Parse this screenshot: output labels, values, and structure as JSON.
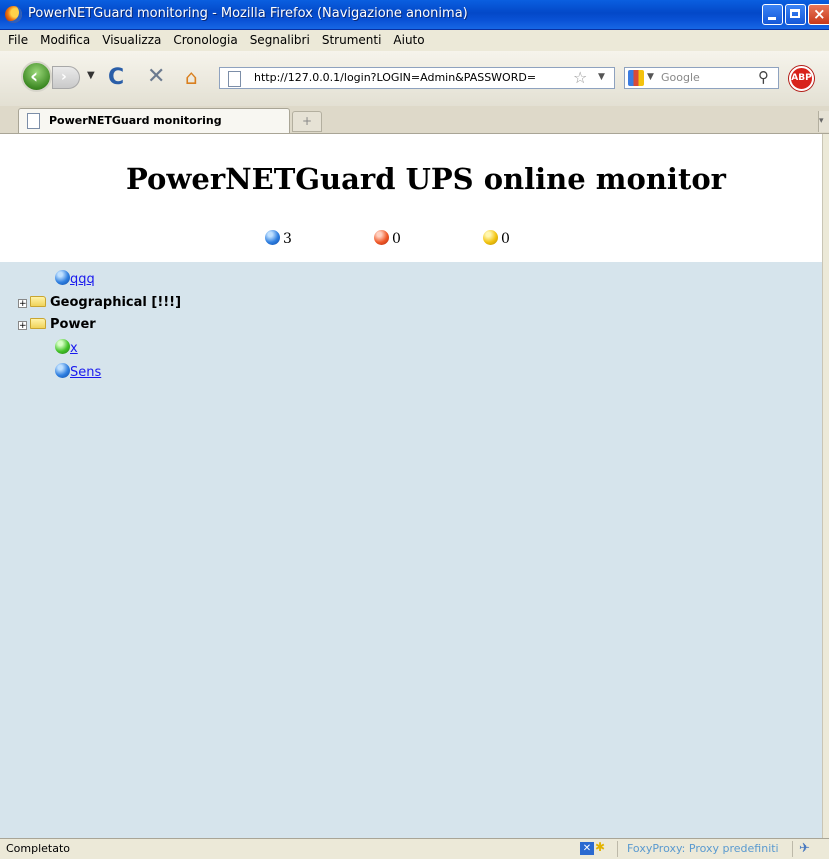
{
  "window": {
    "title": "PowerNETGuard monitoring - Mozilla Firefox (Navigazione anonima)"
  },
  "menu": [
    "File",
    "Modifica",
    "Visualizza",
    "Cronologia",
    "Segnalibri",
    "Strumenti",
    "Aiuto"
  ],
  "navbar": {
    "url": "http://127.0.0.1/login?LOGIN=Admin&PASSWORD=",
    "search_placeholder": "Google",
    "adblock_label": "ABP"
  },
  "tabs": [
    {
      "label": "PowerNETGuard monitoring"
    }
  ],
  "page": {
    "title": "PowerNETGuard UPS online monitor",
    "counters": [
      {
        "color": "blue",
        "value": "3"
      },
      {
        "color": "red",
        "value": "0"
      },
      {
        "color": "yellow",
        "value": "0"
      }
    ],
    "tree": [
      {
        "type": "device",
        "status": "blue",
        "label": "qqq"
      },
      {
        "type": "group",
        "label": "Geographical [!!!]"
      },
      {
        "type": "group",
        "label": "Power"
      },
      {
        "type": "device",
        "status": "green",
        "label": "x"
      },
      {
        "type": "device",
        "status": "blue",
        "label": "Sens"
      }
    ]
  },
  "status": {
    "text": "Completato",
    "proxy": "FoxyProxy: Proxy predefiniti"
  },
  "colors": {
    "titlebar": "#0a52d6",
    "tree_background": "#d6e4ec",
    "link": "#1a1aee"
  }
}
